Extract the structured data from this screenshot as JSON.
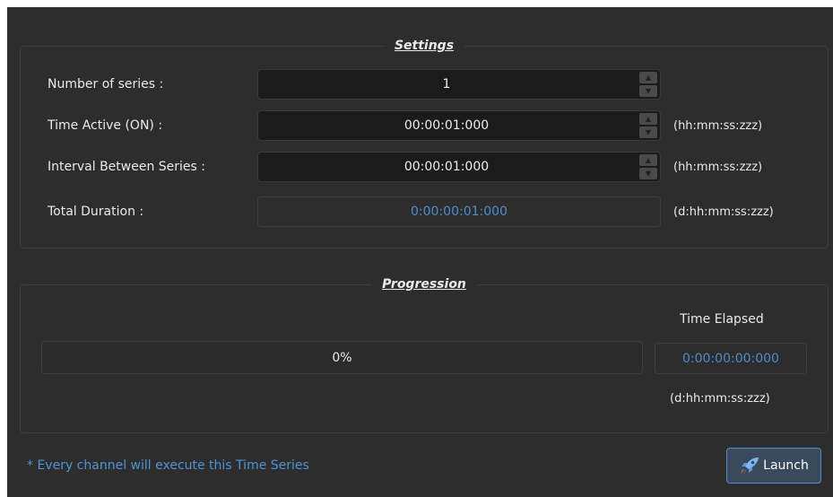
{
  "settings": {
    "title": "Settings",
    "rows": [
      {
        "label": "Number of series :",
        "value": "1",
        "unit": ""
      },
      {
        "label": "Time Active (ON) :",
        "value": "00:00:01:000",
        "unit": "(hh:mm:ss:zzz)"
      },
      {
        "label": "Interval Between Series :",
        "value": "00:00:01:000",
        "unit": "(hh:mm:ss:zzz)"
      },
      {
        "label": "Total Duration :",
        "value": "0:00:00:01:000",
        "unit": "(d:hh:mm:ss:zzz)"
      }
    ]
  },
  "progression": {
    "title": "Progression",
    "progress_text": "0%",
    "progress_fraction": 0,
    "time_elapsed_label": "Time Elapsed",
    "time_elapsed_value": "0:00:00:00:000",
    "time_elapsed_unit": "(d:hh:mm:ss:zzz)"
  },
  "footer": {
    "note": "* Every channel will execute this Time Series",
    "launch_label": "Launch"
  },
  "colors": {
    "background": "#2d2d2d",
    "accent": "#4d8ccd",
    "field": "#1b1b1b"
  },
  "icons": {
    "spin_up": "chevron-up-icon",
    "spin_down": "chevron-down-icon",
    "launch": "rocket-icon"
  }
}
